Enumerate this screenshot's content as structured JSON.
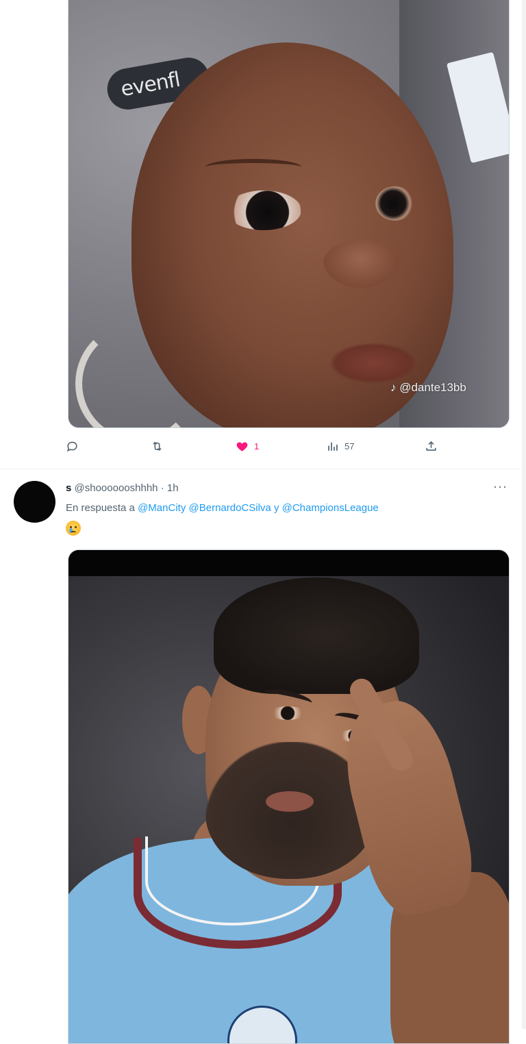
{
  "tweet_1": {
    "media": {
      "brand_text": "evenfl",
      "watermark": "♪ @dante13bb"
    },
    "actions": {
      "reply_count": "",
      "retweet_count": "",
      "like_count": "1",
      "views_count": "57"
    }
  },
  "tweet_2": {
    "display_name": "s",
    "handle": "@shooooooshhhh",
    "separator": "·",
    "time": "1h",
    "more_label": "···",
    "reply_prefix": "En respuesta a",
    "mention_1": "@ManCity",
    "mention_2": "@BernardoCSilva",
    "conjunction": "y",
    "mention_3": "@ChampionsLeague",
    "emoji": "crying-face"
  },
  "colors": {
    "like_pink": "#f91880",
    "mention_blue": "#1d9bf0",
    "secondary_text": "#536471",
    "divider": "#eff3f4"
  }
}
